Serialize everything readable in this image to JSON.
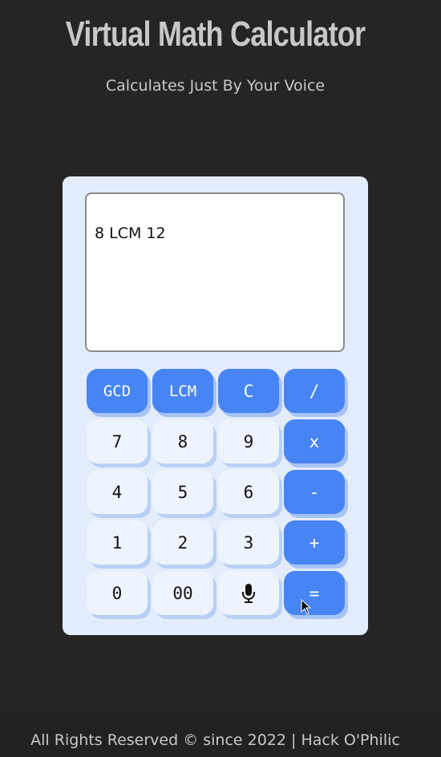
{
  "header": {
    "title": "Virtual Math Calculator",
    "subtitle": "Calculates Just By Your Voice"
  },
  "display": {
    "value": "8 LCM 12"
  },
  "buttons": {
    "gcd": "GCD",
    "lcm": "LCM",
    "clear": "C",
    "divide": "/",
    "seven": "7",
    "eight": "8",
    "nine": "9",
    "multiply": "x",
    "four": "4",
    "five": "5",
    "six": "6",
    "minus": "-",
    "one": "1",
    "two": "2",
    "three": "3",
    "plus": "+",
    "zero": "0",
    "double_zero": "00",
    "mic": "microphone-icon",
    "equals": "="
  },
  "footer": {
    "text": "All Rights Reserved © since 2022 | Hack O'Philic"
  },
  "colors": {
    "background": "#252525",
    "accent": "#4784f4",
    "panel": "#e3ecfa",
    "key": "#eef4fe"
  }
}
